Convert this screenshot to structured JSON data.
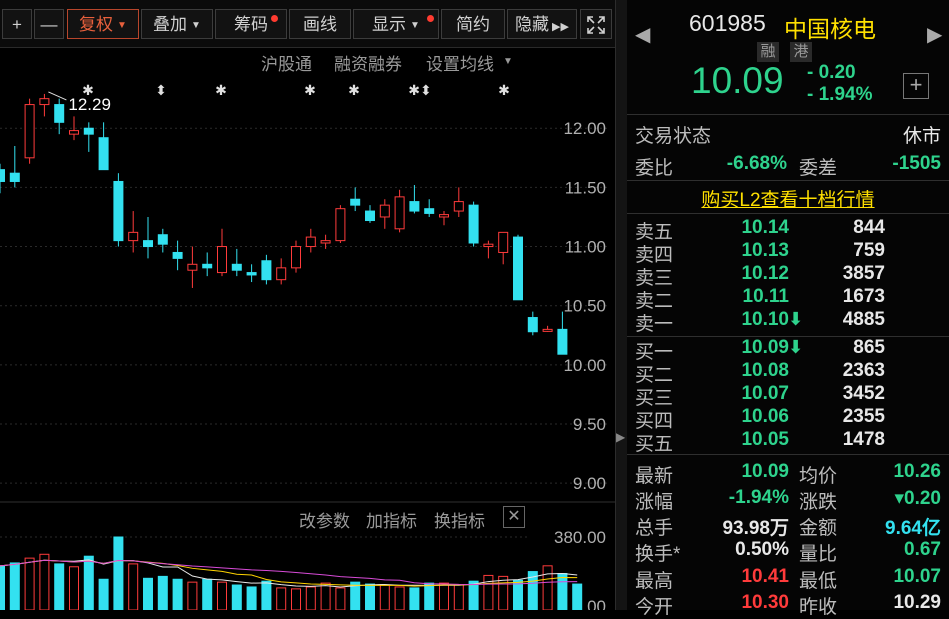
{
  "toolbar": {
    "plus": "+",
    "minus": "—",
    "fuquan": "复权",
    "diejia": "叠加",
    "chouma": "筹码",
    "huaxian": "画线",
    "xianshi": "显示",
    "jianyue": "简约",
    "yincang": "隐藏",
    "fullscreen_icon": "expand-icon"
  },
  "subtools": {
    "hugutong": "沪股通",
    "rongzi": "融资融券",
    "junxian": "设置均线"
  },
  "indicator_tools": {
    "gaicanshu": "改参数",
    "jiazhibiao": "加指标",
    "huanzhibiao": "换指标"
  },
  "chart_data": {
    "type": "candlestick",
    "price_axis": {
      "ticks": [
        "12.00",
        "11.50",
        "11.00",
        "10.50",
        "10.00",
        "9.50",
        "9.00"
      ],
      "ylim": [
        8.9,
        12.45
      ]
    },
    "annotation": "12.29",
    "event_markers": [
      "✱",
      "⬍",
      "✱",
      "✱",
      "✱",
      "✱⬍",
      "✱"
    ],
    "candles": [
      [
        11.65,
        11.7,
        11.45,
        11.55
      ],
      [
        11.62,
        11.85,
        11.5,
        11.55
      ],
      [
        11.75,
        12.25,
        11.7,
        12.2
      ],
      [
        12.2,
        12.29,
        12.1,
        12.25
      ],
      [
        12.2,
        12.25,
        11.95,
        12.05
      ],
      [
        11.95,
        12.1,
        11.9,
        11.98
      ],
      [
        12.0,
        12.05,
        11.8,
        11.95
      ],
      [
        11.92,
        12.05,
        11.7,
        11.65
      ],
      [
        11.55,
        11.62,
        11.0,
        11.05
      ],
      [
        11.05,
        11.3,
        10.95,
        11.12
      ],
      [
        11.05,
        11.25,
        10.9,
        11.0
      ],
      [
        11.1,
        11.15,
        10.95,
        11.02
      ],
      [
        10.95,
        11.05,
        10.8,
        10.9
      ],
      [
        10.8,
        11.0,
        10.65,
        10.85
      ],
      [
        10.85,
        10.95,
        10.75,
        10.82
      ],
      [
        10.78,
        11.15,
        10.75,
        11.0
      ],
      [
        10.85,
        10.98,
        10.75,
        10.8
      ],
      [
        10.78,
        10.85,
        10.7,
        10.76
      ],
      [
        10.88,
        10.93,
        10.68,
        10.72
      ],
      [
        10.72,
        10.9,
        10.68,
        10.82
      ],
      [
        10.82,
        11.05,
        10.78,
        11.0
      ],
      [
        11.0,
        11.15,
        10.95,
        11.08
      ],
      [
        11.03,
        11.1,
        10.98,
        11.05
      ],
      [
        11.05,
        11.35,
        11.03,
        11.32
      ],
      [
        11.4,
        11.5,
        11.3,
        11.35
      ],
      [
        11.3,
        11.35,
        11.2,
        11.22
      ],
      [
        11.25,
        11.4,
        11.15,
        11.35
      ],
      [
        11.15,
        11.48,
        11.12,
        11.42
      ],
      [
        11.38,
        11.52,
        11.28,
        11.3
      ],
      [
        11.32,
        11.4,
        11.25,
        11.28
      ],
      [
        11.25,
        11.3,
        11.18,
        11.27
      ],
      [
        11.3,
        11.5,
        11.25,
        11.38
      ],
      [
        11.35,
        11.38,
        11.0,
        11.03
      ],
      [
        11.0,
        11.05,
        10.9,
        11.02
      ],
      [
        10.95,
        11.1,
        10.85,
        11.12
      ],
      [
        11.08,
        11.1,
        10.55,
        10.55
      ],
      [
        10.4,
        10.45,
        10.25,
        10.28
      ],
      [
        10.3,
        10.33,
        10.28,
        10.3
      ],
      [
        10.3,
        10.45,
        10.1,
        10.09
      ]
    ],
    "volume_axis": {
      "ticks": [
        "380.00",
        "0.00"
      ]
    },
    "volumes": [
      230,
      245,
      270,
      290,
      240,
      225,
      280,
      160,
      380,
      240,
      165,
      175,
      160,
      145,
      160,
      145,
      130,
      120,
      150,
      115,
      110,
      120,
      140,
      115,
      145,
      135,
      130,
      120,
      115,
      140,
      140,
      130,
      150,
      180,
      175,
      155,
      200,
      230,
      190,
      135
    ]
  },
  "quote": {
    "code": "601985",
    "name": "中国核电",
    "tag1": "融",
    "tag2": "港",
    "price": "10.09",
    "change": "- 0.20",
    "pct": "- 1.94%",
    "add_icon": "plus-box-icon"
  },
  "status": {
    "label": "交易状态",
    "value": "休市"
  },
  "weibi": {
    "label": "委比",
    "value": "-6.68%",
    "label2": "委差",
    "value2": "-1505"
  },
  "l2_link": "购买L2查看十档行情",
  "asks": [
    {
      "label": "卖五",
      "price": "10.14",
      "vol": "844"
    },
    {
      "label": "卖四",
      "price": "10.13",
      "vol": "759"
    },
    {
      "label": "卖三",
      "price": "10.12",
      "vol": "3857"
    },
    {
      "label": "卖二",
      "price": "10.11",
      "vol": "1673"
    },
    {
      "label": "卖一",
      "price": "10.10",
      "vol": "4885"
    }
  ],
  "bids": [
    {
      "label": "买一",
      "price": "10.09",
      "vol": "865"
    },
    {
      "label": "买二",
      "price": "10.08",
      "vol": "2363"
    },
    {
      "label": "买三",
      "price": "10.07",
      "vol": "3452"
    },
    {
      "label": "买四",
      "price": "10.06",
      "vol": "2355"
    },
    {
      "label": "买五",
      "price": "10.05",
      "vol": "1478"
    }
  ],
  "stats": {
    "zuixin_l": "最新",
    "zuixin": "10.09",
    "junjia_l": "均价",
    "junjia": "10.26",
    "zhangfu_l": "涨幅",
    "zhangfu": "-1.94%",
    "zhangdie_l": "涨跌",
    "zhangdie": "▾0.20",
    "zongshou_l": "总手",
    "zongshou": "93.98万",
    "jine_l": "金额",
    "jine": "9.64亿",
    "huanshou_l": "换手*",
    "huanshou": "0.50%",
    "liangbi_l": "量比",
    "liangbi": "0.67",
    "zuigao_l": "最高",
    "zuigao": "10.41",
    "zuidi_l": "最低",
    "zuidi": "10.07",
    "jinkai_l": "今开",
    "jinkai": "10.30",
    "zuoshou_l": "昨收",
    "zuoshou": "10.29"
  },
  "colors": {
    "up": "#ff3b3b",
    "down": "#33e1f0",
    "accent": "#e8603c",
    "green": "#2ed38d"
  }
}
